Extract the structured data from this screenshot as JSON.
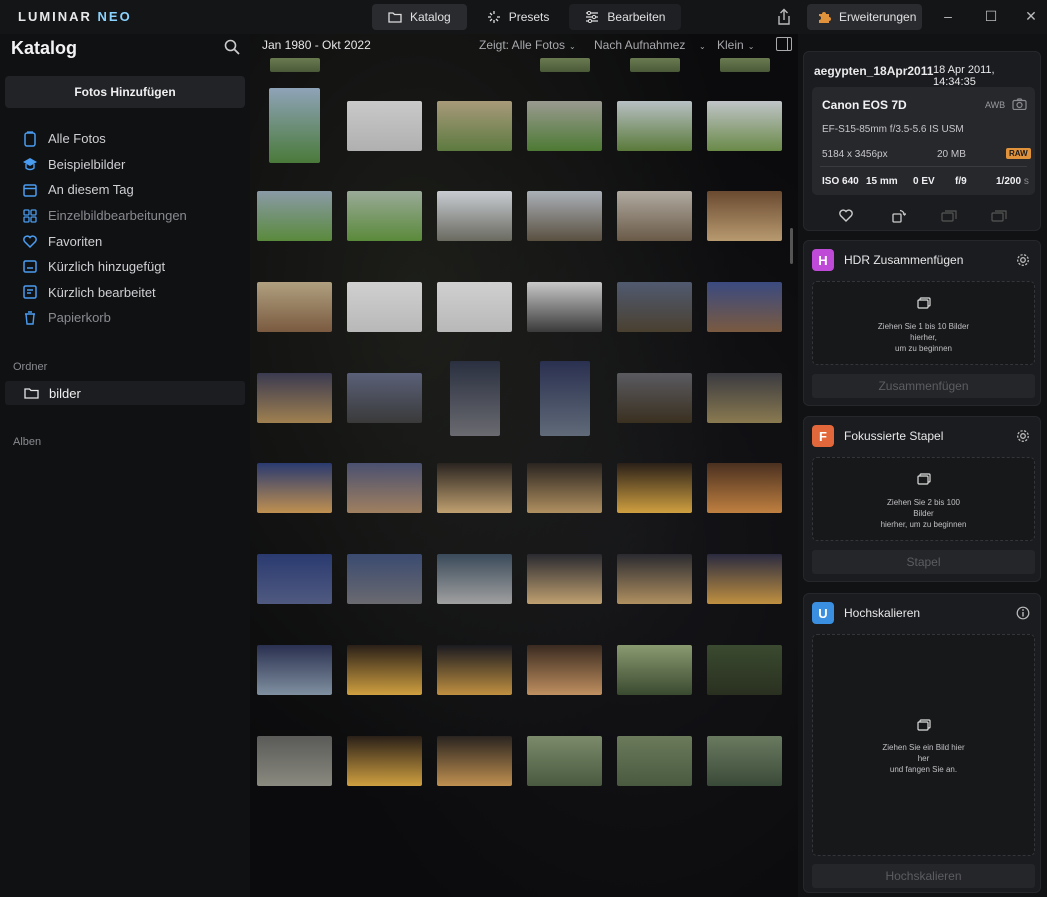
{
  "app": {
    "logo_main": "LUMINAR ",
    "logo_accent": "NEO"
  },
  "topnav": {
    "tabs": [
      {
        "label": "Katalog",
        "icon": "folder-icon",
        "active": true
      },
      {
        "label": "Presets",
        "icon": "sparkle-icon",
        "active": false
      },
      {
        "label": "Bearbeiten",
        "icon": "sliders-icon",
        "active": false
      }
    ],
    "extensions_label": "Erweiterungen"
  },
  "sidebar": {
    "title": "Katalog",
    "add_button": "Fotos Hinzufügen",
    "items": [
      {
        "label": "Alle Fotos",
        "icon": "photo-stack-icon"
      },
      {
        "label": "Beispielbilder",
        "icon": "graduation-cap-icon"
      },
      {
        "label": "An diesem Tag",
        "icon": "calendar-icon"
      },
      {
        "label": "Einzelbildbearbeitungen",
        "icon": "grid-icon"
      },
      {
        "label": "Favoriten",
        "icon": "heart-icon"
      },
      {
        "label": "Kürzlich hinzugefügt",
        "icon": "recent-add-icon"
      },
      {
        "label": "Kürzlich bearbeitet",
        "icon": "recent-edit-icon"
      },
      {
        "label": "Papierkorb",
        "icon": "trash-icon"
      }
    ],
    "folders_label": "Ordner",
    "folder": "bilder",
    "albums_label": "Alben"
  },
  "toolbar": {
    "date_range": "Jan 1980 - Okt 2022",
    "filter": "Zeigt: Alle Fotos",
    "sort": "Nach Aufnahmez",
    "size": "Klein"
  },
  "info": {
    "filename": "aegypten_18Apr2011",
    "date": "18 Apr 2011, 14:34:35",
    "camera": "Canon EOS 7D",
    "awb": "AWB",
    "lens": "EF-S15-85mm f/3.5-5.6 IS USM",
    "resolution": "5184 x 3456px",
    "filesize": "20 MB",
    "format": "RAW",
    "iso": "ISO 640",
    "focal": "15 mm",
    "ev": "0 EV",
    "aperture": "f/9",
    "shutter": "1/200",
    "shutter_unit": "s"
  },
  "extensions": {
    "hdr": {
      "title": "HDR Zusammenfügen",
      "logo": "H",
      "color": "#c04ad8",
      "drop_lines": [
        "Ziehen Sie 1 bis 10 Bilder",
        "hierher,",
        "um zu beginnen"
      ],
      "button": "Zusammenfügen"
    },
    "focus": {
      "title": "Fokussierte Stapel",
      "logo": "F",
      "color": "#e2673a",
      "drop_lines": [
        "Ziehen Sie 2 bis 100",
        "Bilder",
        "hierher, um zu beginnen"
      ],
      "button": "Stapel"
    },
    "upscale": {
      "title": "Hochskalieren",
      "logo": "U",
      "color": "#3a8fe0",
      "drop_lines": [
        "Ziehen Sie ein Bild hier",
        "her",
        "und fangen Sie an."
      ],
      "button": "Hochskalieren"
    }
  },
  "colors": {
    "accent_orange": "#e0933a"
  }
}
